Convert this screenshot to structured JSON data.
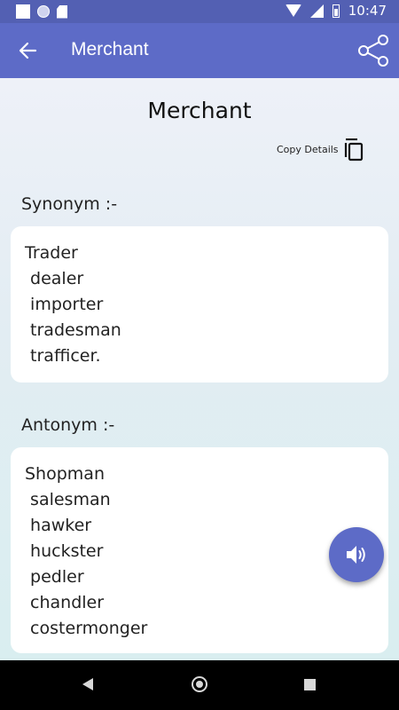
{
  "status_bar": {
    "time": "10:47"
  },
  "app_bar": {
    "title": "Merchant"
  },
  "word": {
    "title": "Merchant",
    "copy_label": "Copy Details"
  },
  "synonym": {
    "label": "Synonym :-",
    "items": [
      "Trader",
      " dealer",
      " importer",
      " tradesman",
      " trafficer."
    ]
  },
  "antonym": {
    "label": "Antonym :-",
    "items": [
      "Shopman",
      " salesman",
      " hawker",
      " huckster",
      " pedler",
      " chandler",
      " costermonger"
    ]
  },
  "icons": {
    "back": "arrow-back-icon",
    "share": "share-icon",
    "copy": "copy-icon",
    "speaker": "volume-icon"
  },
  "colors": {
    "accent": "#5d6bc7",
    "status": "#5360b3"
  }
}
